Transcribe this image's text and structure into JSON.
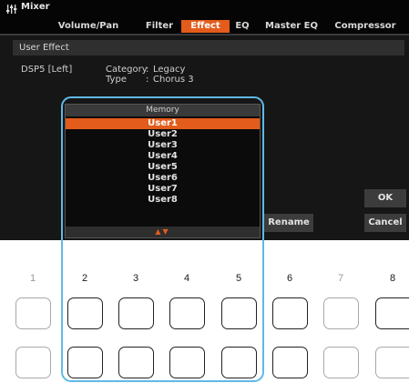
{
  "header": {
    "title": "Mixer",
    "tabs": [
      {
        "label": "Volume/Pan",
        "active": false
      },
      {
        "label": "Filter",
        "active": false
      },
      {
        "label": "Effect",
        "active": true
      },
      {
        "label": "EQ",
        "active": false
      },
      {
        "label": "Master EQ",
        "active": false
      },
      {
        "label": "Compressor",
        "active": false
      }
    ]
  },
  "section_title": "User Effect",
  "effect_info": {
    "part": "DSP5 [Left]",
    "category_label": "Category",
    "category_value": "Legacy",
    "type_label": "Type",
    "type_value": "Chorus 3"
  },
  "memory": {
    "title": "Memory",
    "items": [
      "User1",
      "User2",
      "User3",
      "User4",
      "User5",
      "User6",
      "User7",
      "User8"
    ],
    "selected": "User1",
    "scroll_arrows": "▲▼"
  },
  "buttons": {
    "rename": "Rename",
    "ok": "OK",
    "cancel": "Cancel"
  },
  "panel": {
    "numbers": [
      "1",
      "2",
      "3",
      "4",
      "5",
      "6",
      "7",
      "8"
    ],
    "active_columns": [
      2,
      3,
      4,
      5,
      6,
      8
    ],
    "dimmed_columns": [
      1,
      7
    ]
  },
  "colors": {
    "accent": "#e35c1b",
    "highlight_outline": "#5fb9e5",
    "screen_bg": "#161616"
  }
}
